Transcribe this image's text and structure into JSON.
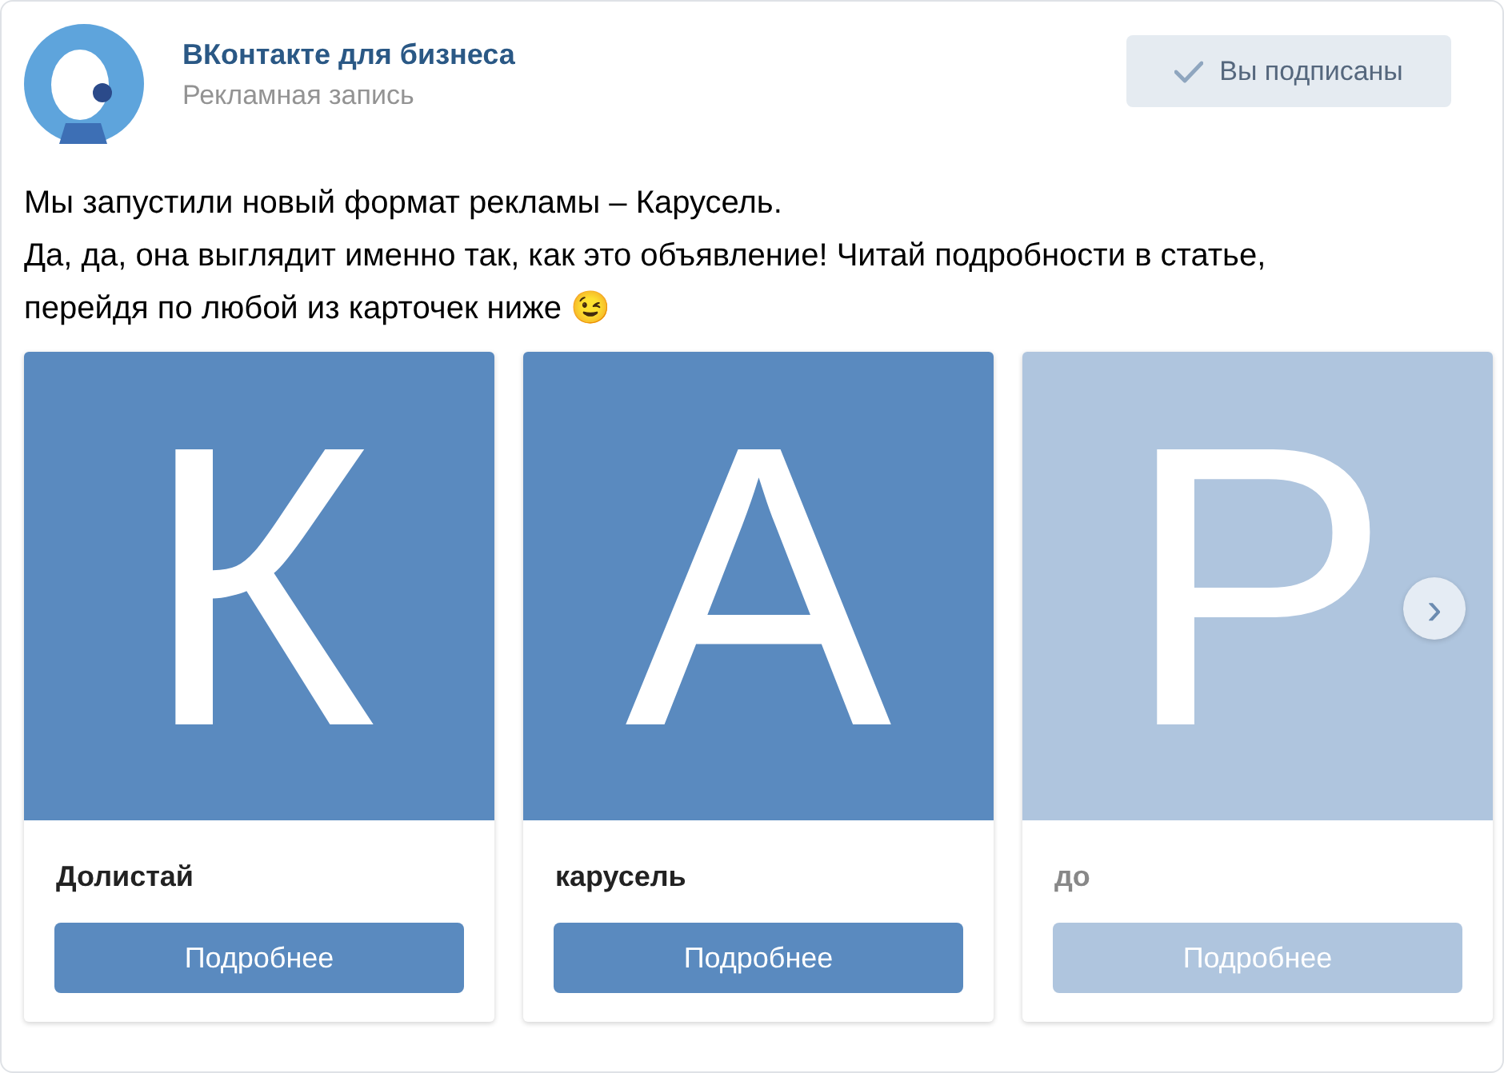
{
  "post": {
    "author": "ВКонтакте для бизнеса",
    "subtitle": "Рекламная запись",
    "subscribe_button": {
      "label": "Вы подписаны",
      "checked": true
    },
    "text_lines": [
      "Мы запустили новый формат рекламы – Карусель.",
      "Да, да, она выглядит именно так, как это объявление! Читай подробности в статье,",
      "перейдя по любой из карточек ниже 😉"
    ]
  },
  "carousel": {
    "cards": [
      {
        "letter": "К",
        "title": "Долистай",
        "button": "Подробнее",
        "faded": false
      },
      {
        "letter": "А",
        "title": "карусель",
        "button": "Подробнее",
        "faded": false
      },
      {
        "letter": "Р",
        "title": "до",
        "button": "Подробнее",
        "faded": true
      }
    ],
    "next_arrow": "›"
  }
}
